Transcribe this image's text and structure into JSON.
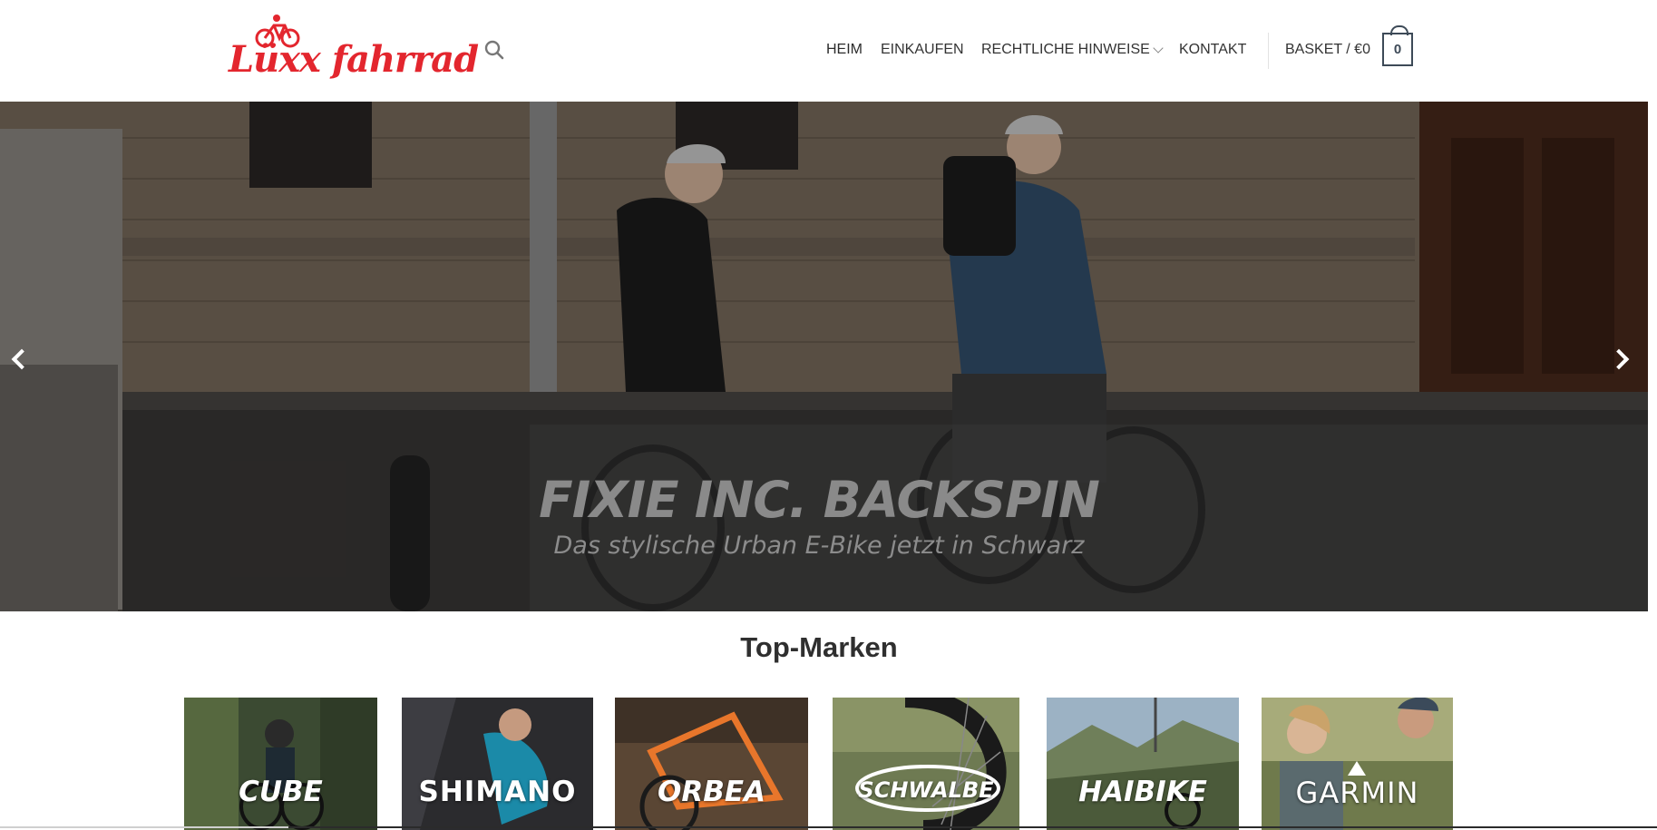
{
  "header": {
    "logo_text": "Lüxx fahrrad",
    "nav": {
      "home": "HEIM",
      "shop": "EINKAUFEN",
      "legal": "RECHTLICHE HINWEISE",
      "contact": "KONTAKT",
      "basket": "BASKET / €0",
      "basket_count": "0"
    }
  },
  "hero": {
    "title": "FIXIE INC. BACKSPIN",
    "subtitle": "Das stylische Urban E-Bike jetzt in Schwarz"
  },
  "brands": {
    "title": "Top-Marken",
    "items": [
      {
        "label": "CUBE"
      },
      {
        "label": "SHIMANO"
      },
      {
        "label": "ORBEA"
      },
      {
        "label": "SCHWALBE"
      },
      {
        "label": "HAIBIKE"
      },
      {
        "label": "GARMIN"
      }
    ]
  },
  "colors": {
    "brand_red": "#e3262e",
    "nav_text": "#6a6a6a",
    "nav_active": "#2b2b2b",
    "basket_border": "#3d4a57"
  }
}
